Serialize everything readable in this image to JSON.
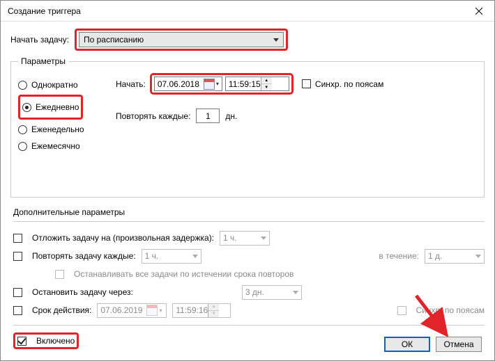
{
  "window": {
    "title": "Создание триггера"
  },
  "begin": {
    "label": "Начать задачу:",
    "selected": "По расписанию"
  },
  "params": {
    "legend": "Параметры",
    "freq": {
      "once": "Однократно",
      "daily": "Ежедневно",
      "weekly": "Еженедельно",
      "monthly": "Ежемесячно"
    },
    "start_label": "Начать:",
    "start_date": "07.06.2018",
    "start_time": "11:59:15",
    "sync_tz": "Синхр. по поясам",
    "repeat_every_label": "Повторять каждые:",
    "repeat_every_value": "1",
    "repeat_every_unit": "дн."
  },
  "adv": {
    "title": "Дополнительные параметры",
    "delay_label": "Отложить задачу на (произвольная задержка):",
    "delay_value": "1 ч.",
    "repeat_label": "Повторять задачу каждые:",
    "repeat_value": "1 ч.",
    "duration_label": "в течение:",
    "duration_value": "1 д.",
    "stop_all_label": "Останавливать все задачи по истечении срока повторов",
    "stop_after_label": "Остановить задачу через:",
    "stop_after_value": "3 дн.",
    "expires_label": "Срок действия:",
    "expires_date": "07.06.2019",
    "expires_time": "11:59:16",
    "sync_tz": "Синхр. по поясам",
    "enabled": "Включено"
  },
  "buttons": {
    "ok": "ОК",
    "cancel": "Отмена"
  }
}
